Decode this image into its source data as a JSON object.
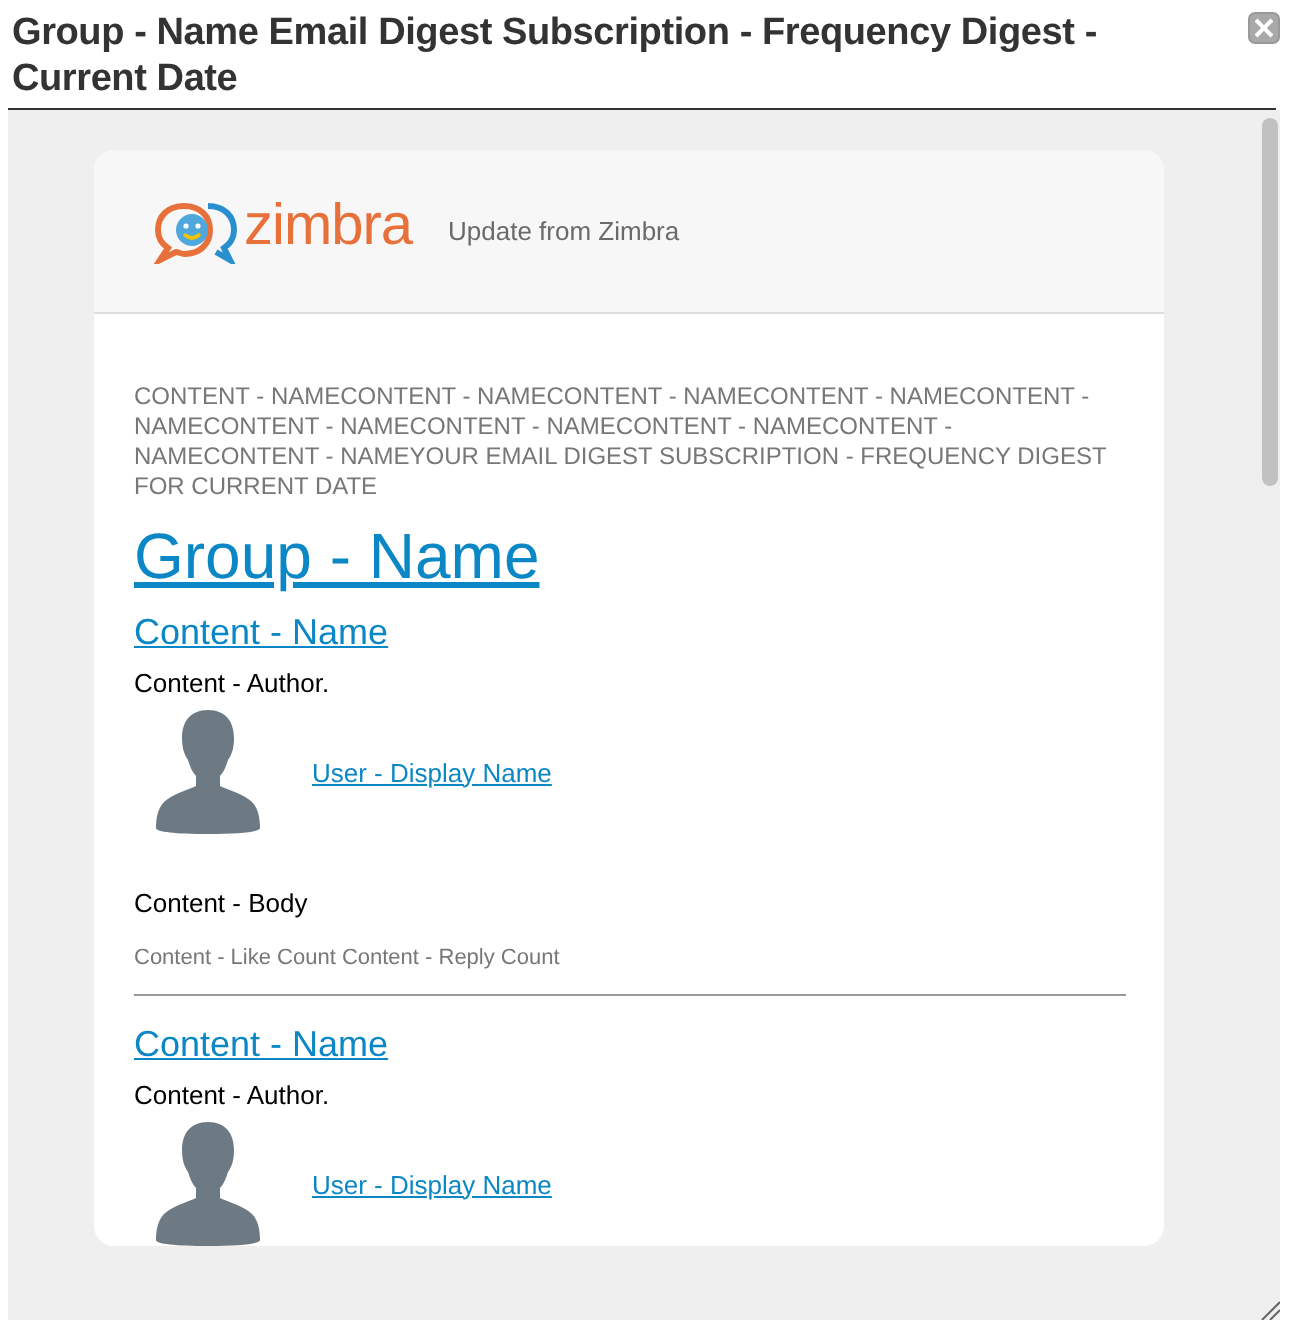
{
  "window": {
    "title": "Group - Name Email Digest Subscription - Frequency Digest - Current Date"
  },
  "header": {
    "wordmark": "zimbra",
    "tagline": "Update from Zimbra"
  },
  "preheader": "CONTENT - NAMECONTENT - NAMECONTENT - NAMECONTENT - NAMECONTENT - NAMECONTENT - NAMECONTENT - NAMECONTENT - NAMECONTENT - NAMECONTENT - NAMEYOUR EMAIL DIGEST SUBSCRIPTION - FREQUENCY DIGEST FOR CURRENT DATE",
  "group_name": "Group - Name",
  "posts": [
    {
      "title": "Content - Name",
      "author": "Content - Author.",
      "user": "User - Display Name",
      "body": "Content - Body",
      "counts": "Content - Like Count Content - Reply Count"
    },
    {
      "title": "Content - Name",
      "author": "Content - Author.",
      "user": "User - Display Name"
    }
  ]
}
